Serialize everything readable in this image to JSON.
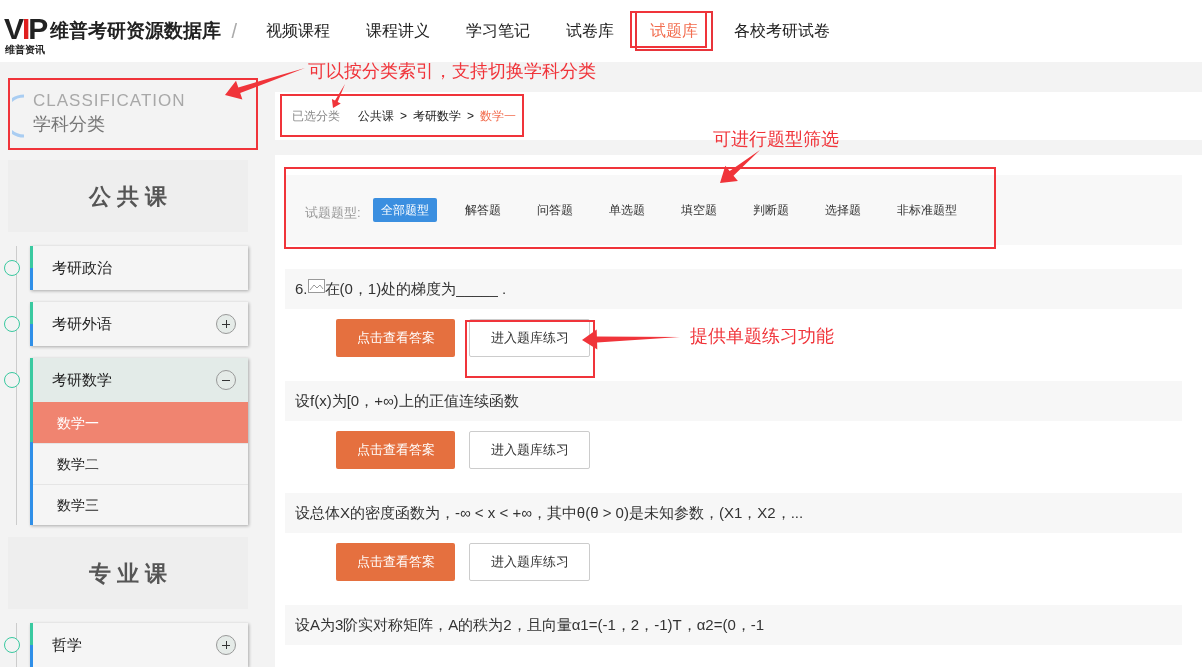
{
  "header": {
    "logo_text": "VIP",
    "logo_caption": "维普资讯",
    "site_title": "维普考研资源数据库",
    "separator": "/",
    "nav": [
      {
        "label": "视频课程",
        "selected": false
      },
      {
        "label": "课程讲义",
        "selected": false
      },
      {
        "label": "学习笔记",
        "selected": false
      },
      {
        "label": "试卷库",
        "selected": false
      },
      {
        "label": "试题库",
        "selected": true
      },
      {
        "label": "各校考研试卷",
        "selected": false
      }
    ]
  },
  "sidebar": {
    "heading_en": "CLASSIFICATION",
    "heading": "学科分类",
    "sections": [
      {
        "title": "公 共 课",
        "items": [
          {
            "label": "考研政治"
          },
          {
            "label": "考研外语",
            "expanded": false
          },
          {
            "label": "考研数学",
            "expanded": true,
            "children": [
              {
                "label": "数学一",
                "selected": true
              },
              {
                "label": "数学二",
                "selected": false
              },
              {
                "label": "数学三",
                "selected": false
              }
            ]
          }
        ]
      },
      {
        "title": "专 业 课",
        "items": [
          {
            "label": "哲学",
            "expanded": false
          }
        ]
      }
    ]
  },
  "breadcrumb": {
    "label": "已选分类",
    "separator": ">",
    "path": [
      {
        "label": "公共课",
        "current": false
      },
      {
        "label": "考研数学",
        "current": false
      },
      {
        "label": "数学一",
        "current": true
      }
    ]
  },
  "filter": {
    "label": "试题题型:",
    "types": [
      {
        "label": "全部题型",
        "selected": true
      },
      {
        "label": "解答题",
        "selected": false
      },
      {
        "label": "问答题",
        "selected": false
      },
      {
        "label": "单选题",
        "selected": false
      },
      {
        "label": "填空题",
        "selected": false
      },
      {
        "label": "判断题",
        "selected": false
      },
      {
        "label": "选择题",
        "selected": false
      },
      {
        "label": "非标准题型",
        "selected": false
      }
    ]
  },
  "questions": [
    {
      "number": "6.",
      "has_image": true,
      "text": "在(0，1)处的梯度为_____ .",
      "answer_button": "点击查看答案",
      "practice_button": "进入题库练习"
    },
    {
      "text": "设f(x)为[0，+∞)上的正值连续函数",
      "answer_button": "点击查看答案",
      "practice_button": "进入题库练习"
    },
    {
      "text": "设总体X的密度函数为，-∞ < x < +∞，其中θ(θ > 0)是未知参数，(X1，X2，...",
      "answer_button": "点击查看答案",
      "practice_button": "进入题库练习"
    },
    {
      "text": "设A为3阶实对称矩阵，A的秩为2，且向量α1=(-1，2，-1)T，α2=(0，-1"
    }
  ],
  "annotations": [
    {
      "text": "可以按分类索引，支持切换学科分类"
    },
    {
      "text": "可进行题型筛选"
    },
    {
      "text": "提供单题练习功能"
    }
  ]
}
